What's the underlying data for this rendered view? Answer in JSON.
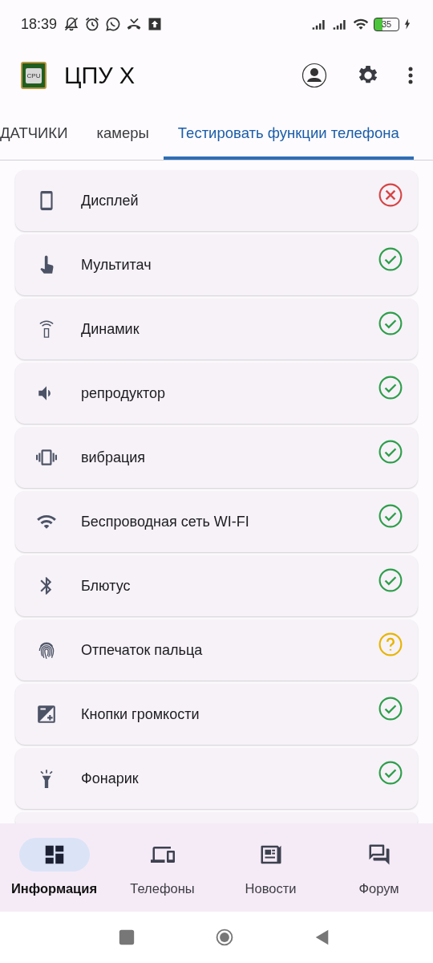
{
  "status_bar": {
    "time": "18:39",
    "battery": "35"
  },
  "app_bar": {
    "title": "ЦПУ X",
    "logo_text": "CPU"
  },
  "tabs": [
    {
      "label": "ДАТЧИКИ",
      "selected": false
    },
    {
      "label": "камеры",
      "selected": false
    },
    {
      "label": "Тестировать функции телефона",
      "selected": true
    }
  ],
  "tests": [
    {
      "label": "Дисплей",
      "kind": "fail"
    },
    {
      "label": "Мультитач",
      "kind": "pass"
    },
    {
      "label": "Динамик",
      "kind": "pass"
    },
    {
      "label": "репродуктор",
      "kind": "pass"
    },
    {
      "label": "вибрация",
      "kind": "pass"
    },
    {
      "label": "Беспроводная сеть WI-FI",
      "kind": "pass"
    },
    {
      "label": "Блютус",
      "kind": "pass"
    },
    {
      "label": "Отпечаток пальца",
      "kind": "unknown"
    },
    {
      "label": "Кнопки громкости",
      "kind": "pass"
    },
    {
      "label": "Фонарик",
      "kind": "pass"
    }
  ],
  "bottom_nav": [
    {
      "label": "Информация",
      "selected": true
    },
    {
      "label": "Телефоны",
      "selected": false
    },
    {
      "label": "Новости",
      "selected": false
    },
    {
      "label": "Форум",
      "selected": false
    }
  ]
}
